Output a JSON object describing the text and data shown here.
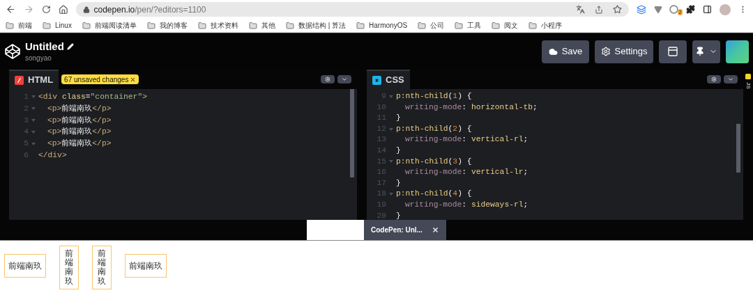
{
  "browser": {
    "url_host": "codepen.io",
    "url_path": "/pen/?editors=1100",
    "extension_badge": "2",
    "bookmarks": [
      "前端",
      "Linux",
      "前端阅读清单",
      "我的博客",
      "技术资料",
      "其他",
      "数据结构 | 算法",
      "HarmonyOS",
      "公司",
      "工具",
      "阅文",
      "小程序"
    ]
  },
  "pen": {
    "title": "Untitled",
    "author": "songyao"
  },
  "header_buttons": [
    {
      "kind": "save",
      "label": "Save"
    },
    {
      "kind": "settings",
      "label": "Settings"
    },
    {
      "kind": "layout"
    },
    {
      "kind": "pin"
    }
  ],
  "editors": [
    {
      "kind": "html",
      "label": "HTML",
      "badge": "67 unsaved changes",
      "lines": [
        {
          "number": "1",
          "fold": true,
          "indented": false,
          "tokens": [
            {
              "kind": "tag",
              "text": "<div "
            },
            {
              "kind": "attr",
              "text": "class"
            },
            {
              "kind": "plain",
              "text": "="
            },
            {
              "kind": "string",
              "text": "\"container\""
            },
            {
              "kind": "tag",
              "text": ">"
            }
          ]
        },
        {
          "number": "2",
          "fold": true,
          "indented": true,
          "tokens": [
            {
              "kind": "tag",
              "text": "<p>"
            },
            {
              "kind": "plain",
              "text": "前端南玖"
            },
            {
              "kind": "tag",
              "text": "</p>"
            }
          ]
        },
        {
          "number": "3",
          "fold": true,
          "indented": true,
          "tokens": [
            {
              "kind": "tag",
              "text": "<p>"
            },
            {
              "kind": "plain",
              "text": "前端南玖"
            },
            {
              "kind": "tag",
              "text": "</p>"
            }
          ]
        },
        {
          "number": "4",
          "fold": true,
          "indented": true,
          "tokens": [
            {
              "kind": "tag",
              "text": "<p>"
            },
            {
              "kind": "plain",
              "text": "前端南玖"
            },
            {
              "kind": "tag",
              "text": "</p>"
            }
          ]
        },
        {
          "number": "5",
          "fold": true,
          "indented": true,
          "tokens": [
            {
              "kind": "tag",
              "text": "<p>"
            },
            {
              "kind": "plain",
              "text": "前端南玖"
            },
            {
              "kind": "tag",
              "text": "</p>"
            }
          ]
        },
        {
          "number": "6",
          "fold": false,
          "indented": false,
          "tokens": [
            {
              "kind": "tag",
              "text": "</div>"
            }
          ]
        }
      ]
    },
    {
      "kind": "css",
      "label": "CSS",
      "lines": [
        {
          "number": "9",
          "fold": true,
          "indented": false,
          "tokens": [
            {
              "kind": "selector",
              "text": "p:nth-child"
            },
            {
              "kind": "plain",
              "text": "("
            },
            {
              "kind": "number",
              "text": "1"
            },
            {
              "kind": "plain",
              "text": ") {"
            }
          ]
        },
        {
          "number": "10",
          "fold": false,
          "indented": true,
          "tokens": [
            {
              "kind": "property",
              "text": "writing-mode"
            },
            {
              "kind": "plain",
              "text": ": "
            },
            {
              "kind": "value",
              "text": "horizontal-tb"
            },
            {
              "kind": "plain",
              "text": ";"
            }
          ]
        },
        {
          "number": "11",
          "fold": false,
          "indented": false,
          "tokens": [
            {
              "kind": "plain",
              "text": "}"
            }
          ]
        },
        {
          "number": "12",
          "fold": true,
          "indented": false,
          "tokens": [
            {
              "kind": "selector",
              "text": "p:nth-child"
            },
            {
              "kind": "plain",
              "text": "("
            },
            {
              "kind": "number",
              "text": "2"
            },
            {
              "kind": "plain",
              "text": ") {"
            }
          ]
        },
        {
          "number": "13",
          "fold": false,
          "indented": true,
          "tokens": [
            {
              "kind": "property",
              "text": "writing-mode"
            },
            {
              "kind": "plain",
              "text": ": "
            },
            {
              "kind": "value",
              "text": "vertical-rl"
            },
            {
              "kind": "plain",
              "text": ";"
            }
          ]
        },
        {
          "number": "14",
          "fold": false,
          "indented": false,
          "tokens": [
            {
              "kind": "plain",
              "text": "}"
            }
          ]
        },
        {
          "number": "15",
          "fold": true,
          "indented": false,
          "tokens": [
            {
              "kind": "selector",
              "text": "p:nth-child"
            },
            {
              "kind": "plain",
              "text": "("
            },
            {
              "kind": "number",
              "text": "3"
            },
            {
              "kind": "plain",
              "text": ") {"
            }
          ]
        },
        {
          "number": "16",
          "fold": false,
          "indented": true,
          "tokens": [
            {
              "kind": "property",
              "text": "writing-mode"
            },
            {
              "kind": "plain",
              "text": ": "
            },
            {
              "kind": "value",
              "text": "vertical-lr"
            },
            {
              "kind": "plain",
              "text": ";"
            }
          ]
        },
        {
          "number": "17",
          "fold": false,
          "indented": false,
          "tokens": [
            {
              "kind": "plain",
              "text": "}"
            }
          ]
        },
        {
          "number": "18",
          "fold": true,
          "indented": false,
          "tokens": [
            {
              "kind": "selector",
              "text": "p:nth-child"
            },
            {
              "kind": "plain",
              "text": "("
            },
            {
              "kind": "number",
              "text": "4"
            },
            {
              "kind": "plain",
              "text": ") {"
            }
          ]
        },
        {
          "number": "19",
          "fold": false,
          "indented": true,
          "tokens": [
            {
              "kind": "property",
              "text": "writing-mode"
            },
            {
              "kind": "plain",
              "text": ": "
            },
            {
              "kind": "value",
              "text": "sideways-rl"
            },
            {
              "kind": "plain",
              "text": ";"
            }
          ]
        },
        {
          "number": "20",
          "fold": false,
          "indented": false,
          "tokens": [
            {
              "kind": "plain",
              "text": "}"
            }
          ]
        }
      ]
    }
  ],
  "side_tab": "JS",
  "console": {
    "tab": "CodePen: Unl..."
  },
  "preview": [
    {
      "kind": "horizontal",
      "text": "前端南玖"
    },
    {
      "kind": "vertical",
      "text": "前端南玖"
    },
    {
      "kind": "vertical",
      "text": "前端南玖"
    },
    {
      "kind": "horizontal",
      "text": "前端南玖"
    }
  ]
}
